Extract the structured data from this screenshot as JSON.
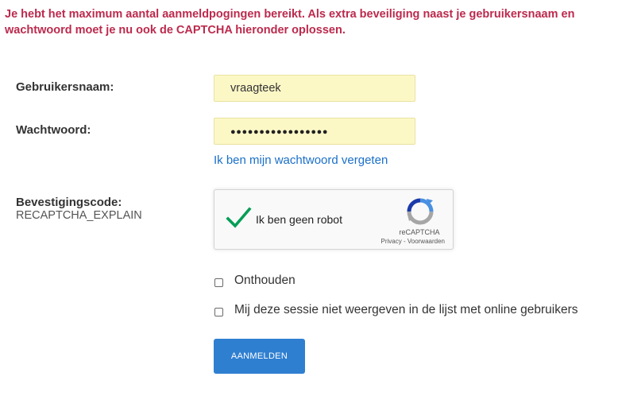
{
  "error_message": "Je hebt het maximum aantal aanmeldpogingen bereikt. Als extra beveiliging naast je gebruikersnaam en wachtwoord moet je nu ook de CAPTCHA hieronder oplossen.",
  "colors": {
    "error": "#bc2a4d",
    "link": "#1a6fc9",
    "button": "#2f7fd1",
    "field_autofill": "#fcf8c6",
    "check_green": "#009e55"
  },
  "form": {
    "username": {
      "label": "Gebruikersnaam:",
      "value": "vraagteek"
    },
    "password": {
      "label": "Wachtwoord:",
      "masked_value": "●●●●●●●●●●●●●●●●●"
    },
    "forgot_password_link": "Ik ben mijn wachtwoord vergeten",
    "captcha": {
      "label": "Bevestigingscode:",
      "explain": "RECAPTCHA_EXPLAIN",
      "checkbox_label": "Ik ben geen robot",
      "checked": true,
      "brand": "reCAPTCHA",
      "privacy_link": "Privacy",
      "separator": " - ",
      "terms_link": "Voorwaarden",
      "icon": "recaptcha-logo-icon",
      "check_icon": "checkmark-icon"
    },
    "remember_me": {
      "label": "Onthouden",
      "checked": false
    },
    "hide_session": {
      "label": "Mij deze sessie niet weergeven in de lijst met online gebruikers",
      "checked": false
    },
    "submit_label": "AANMELDEN"
  }
}
